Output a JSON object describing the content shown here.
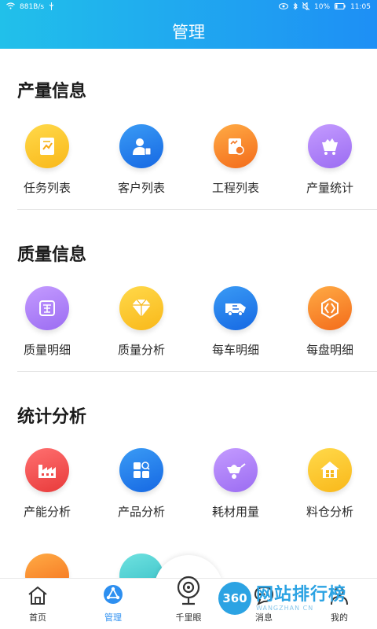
{
  "status_bar": {
    "network_speed": "881B/s",
    "battery": "10%",
    "time": "11:05"
  },
  "header": {
    "title": "管理"
  },
  "sections": [
    {
      "title": "产量信息",
      "items": [
        {
          "label": "任务列表",
          "icon": "task-list-icon",
          "color": "#f9c020"
        },
        {
          "label": "客户列表",
          "icon": "customer-icon",
          "color": "#1f7ae8"
        },
        {
          "label": "工程列表",
          "icon": "project-icon",
          "color": "#f5822a"
        },
        {
          "label": "产量统计",
          "icon": "production-cart-icon",
          "color": "#a97cf5"
        }
      ]
    },
    {
      "title": "质量信息",
      "items": [
        {
          "label": "质量明细",
          "icon": "quality-detail-icon",
          "color": "#a97cf5"
        },
        {
          "label": "质量分析",
          "icon": "diamond-icon",
          "color": "#f9c020"
        },
        {
          "label": "每车明细",
          "icon": "truck-icon",
          "color": "#1f7ae8"
        },
        {
          "label": "每盘明细",
          "icon": "plate-icon",
          "color": "#f5822a"
        }
      ]
    },
    {
      "title": "统计分析",
      "items": [
        {
          "label": "产能分析",
          "icon": "factory-icon",
          "color": "#ee4a4a"
        },
        {
          "label": "产品分析",
          "icon": "product-grid-icon",
          "color": "#1f7ae8"
        },
        {
          "label": "耗材用量",
          "icon": "wheelbarrow-icon",
          "color": "#a97cf5"
        },
        {
          "label": "料仓分析",
          "icon": "silo-icon",
          "color": "#f9c020"
        }
      ]
    }
  ],
  "tabbar": {
    "items": [
      {
        "label": "首页",
        "icon": "home-icon"
      },
      {
        "label": "管理",
        "icon": "manage-icon",
        "active": true
      },
      {
        "label": "千里眼",
        "icon": "camera-icon"
      },
      {
        "label": "消息",
        "icon": "message-icon"
      },
      {
        "label": "我的",
        "icon": "profile-icon"
      }
    ]
  },
  "watermark": {
    "badge": "360",
    "text": "网站排行榜",
    "sub": "WANGZHAN  CN"
  }
}
